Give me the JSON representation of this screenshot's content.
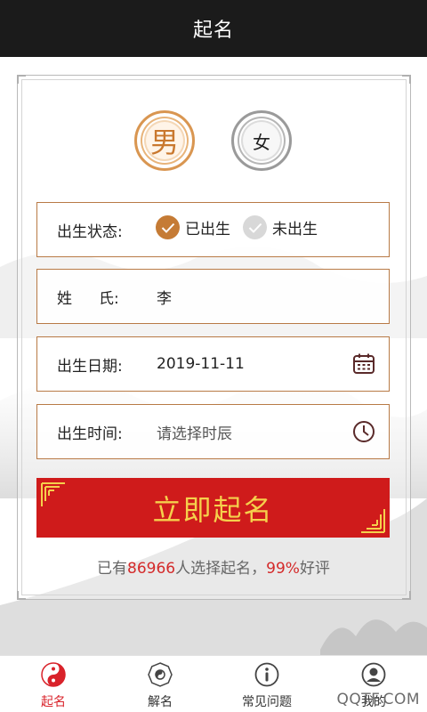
{
  "header": {
    "title": "起名"
  },
  "gender": {
    "male": "男",
    "female": "女",
    "selected": "male"
  },
  "form": {
    "birth_status": {
      "label": "出生状态:",
      "options": [
        "已出生",
        "未出生"
      ],
      "selected": "已出生"
    },
    "surname": {
      "label_chars": [
        "姓",
        "氏:"
      ],
      "value": "李"
    },
    "birth_date": {
      "label": "出生日期:",
      "value": "2019-11-11",
      "icon": "calendar-icon"
    },
    "birth_time": {
      "label": "出生时间:",
      "placeholder": "请选择时辰",
      "icon": "clock-icon"
    }
  },
  "submit": {
    "label": "立即起名"
  },
  "stats": {
    "prefix": "已有",
    "count": "86966",
    "middle": "人选择起名，",
    "rate": "99%",
    "suffix": "好评"
  },
  "tabs": [
    {
      "label": "起名",
      "icon": "yin-yang-icon",
      "active": true
    },
    {
      "label": "解名",
      "icon": "bagua-icon",
      "active": false
    },
    {
      "label": "常见问题",
      "icon": "info-icon",
      "active": false
    },
    {
      "label": "我的",
      "icon": "user-icon",
      "active": false
    }
  ],
  "watermark": "QQTF.COM",
  "colors": {
    "accent_red": "#cf1b1b",
    "gold": "#f5d04c",
    "brown": "#c57b35",
    "active_tab": "#d9222a"
  }
}
